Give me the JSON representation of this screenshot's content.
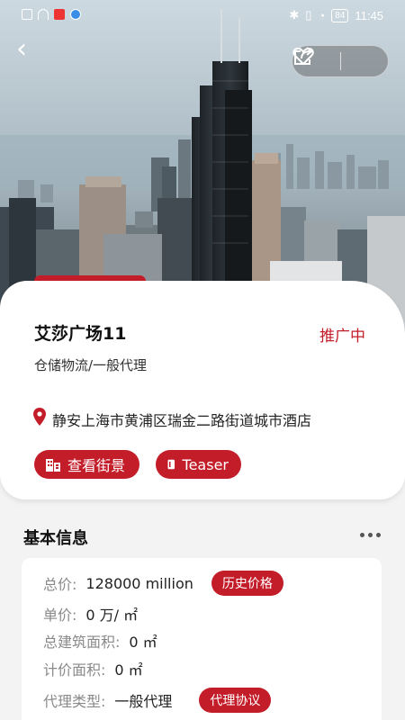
{
  "status_bar": {
    "battery": "84",
    "time": "11:45"
  },
  "colors": {
    "accent": "#c41d2a",
    "muted_label": "#8a8a8a",
    "background": "#f3f3f3"
  },
  "property": {
    "title": "艾莎广场11",
    "status_badge": "推广中",
    "category": "仓储物流/一般代理",
    "address": "静安上海市黄浦区瑞金二路街道城市酒店",
    "street_view_label": "查看街景",
    "teaser_label": "Teaser"
  },
  "basic_info": {
    "section_title": "基本信息",
    "total_price_label": "总价:",
    "total_price_value": "128000 million",
    "price_history_label": "历史价格",
    "unit_price_label": "单价:",
    "unit_price_value": "0 万/ ㎡",
    "gross_area_label": "总建筑面积:",
    "gross_area_value": "0 ㎡",
    "priced_area_label": "计价面积:",
    "priced_area_value": "0 ㎡",
    "agency_type_label": "代理类型:",
    "agency_type_value": "一般代理",
    "agency_agreement_label": "代理协议"
  }
}
